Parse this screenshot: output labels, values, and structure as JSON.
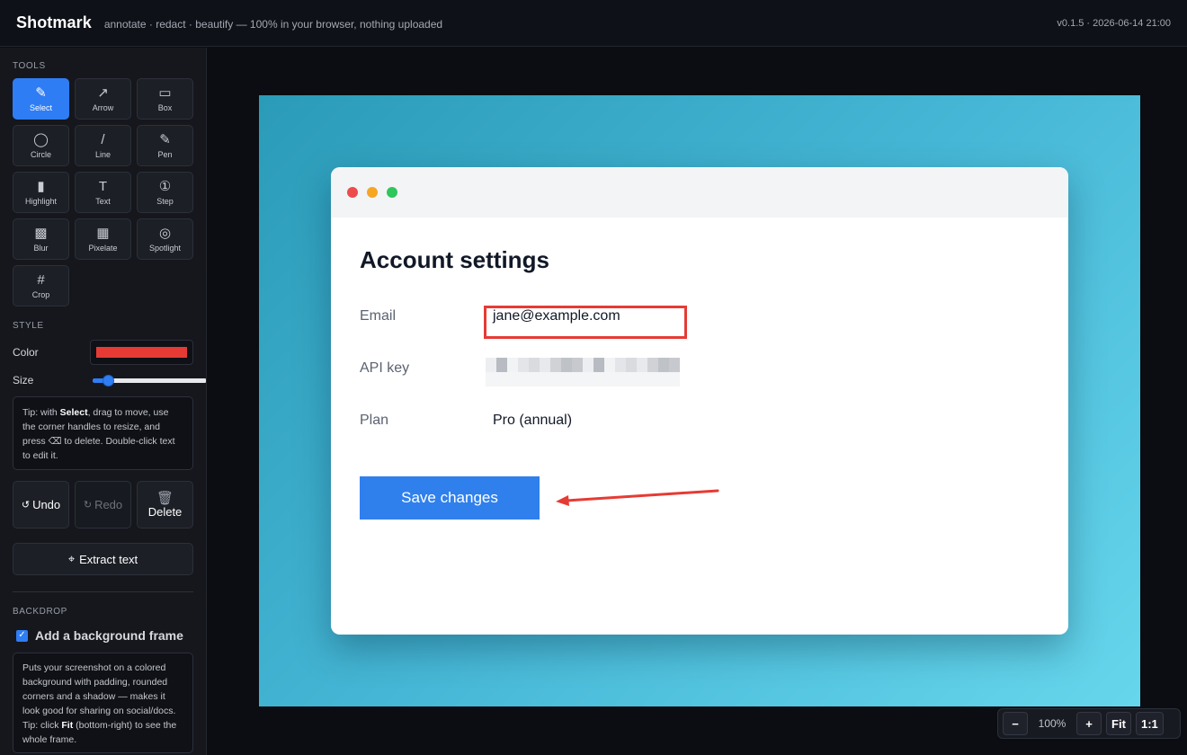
{
  "header": {
    "brand": "Shotmark",
    "tagline": "annotate · redact · beautify — 100% in your browser, nothing uploaded",
    "version": "v0.1.5 · 2026-06-14 21:00"
  },
  "sidebar": {
    "tools_label": "TOOLS",
    "tools": [
      {
        "label": "Select",
        "icon": "✎",
        "icon_name": "select-icon",
        "active": true
      },
      {
        "label": "Arrow",
        "icon": "↗",
        "icon_name": "arrow-icon"
      },
      {
        "label": "Box",
        "icon": "▭",
        "icon_name": "box-icon"
      },
      {
        "label": "Circle",
        "icon": "◯",
        "icon_name": "circle-icon"
      },
      {
        "label": "Line",
        "icon": "/",
        "icon_name": "line-icon"
      },
      {
        "label": "Pen",
        "icon": "✎",
        "icon_name": "pen-icon"
      },
      {
        "label": "Highlight",
        "icon": "▮",
        "icon_name": "highlight-icon"
      },
      {
        "label": "Text",
        "icon": "T",
        "icon_name": "text-icon"
      },
      {
        "label": "Step",
        "icon": "①",
        "icon_name": "step-icon"
      },
      {
        "label": "Blur",
        "icon": "▩",
        "icon_name": "blur-icon"
      },
      {
        "label": "Pixelate",
        "icon": "▦",
        "icon_name": "pixelate-icon"
      },
      {
        "label": "Spotlight",
        "icon": "◎",
        "icon_name": "spotlight-icon"
      },
      {
        "label": "Crop",
        "icon": "#",
        "icon_name": "crop-icon"
      }
    ],
    "style_label": "STYLE",
    "color_label": "Color",
    "color_value": "#e63b34",
    "size_label": "Size",
    "size_level": 0.1,
    "tip_prefix": "Tip: with ",
    "tip_bold": "Select",
    "tip_suffix": ", drag to move, use the corner handles to resize, and press ⌫ to delete. Double-click text to edit it.",
    "undo_icon": "↺",
    "undo_label": "Undo",
    "redo_icon": "↻",
    "redo_label": "Redo",
    "delete_icon": "🗑",
    "delete_label": "Delete",
    "extract_icon": "⌖",
    "extract_label": "Extract text",
    "backdrop_label": "BACKDROP",
    "backdrop_checkbox_label": "Add a background frame",
    "backdrop_checked": true,
    "backdrop_tip_prefix": "Puts your screenshot on a colored background with padding, rounded corners and a shadow — makes it look good for sharing on social/docs. Tip: click ",
    "backdrop_tip_bold": "Fit",
    "backdrop_tip_suffix": " (bottom-right) to see the whole frame."
  },
  "canvas": {
    "window": {
      "title": "Account settings",
      "email_label": "Email",
      "email_value": "jane@example.com",
      "api_key_label": "API key",
      "plan_label": "Plan",
      "plan_value": "Pro (annual)",
      "save_button": "Save changes"
    }
  },
  "zoom": {
    "minus": "−",
    "level": "100%",
    "plus": "+",
    "fit": "Fit",
    "one_to_one": "1:1"
  }
}
